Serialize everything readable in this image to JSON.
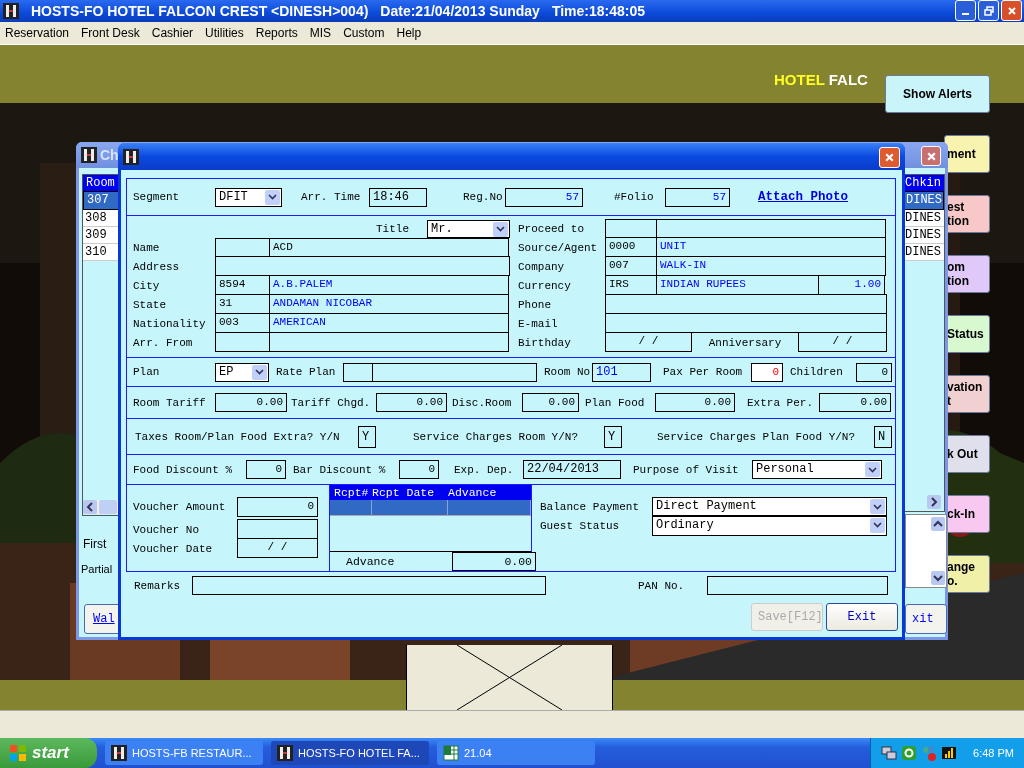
{
  "app_title": "HOSTS-FO HOTEL FALCON CREST <DINESH>004)",
  "app_date": "Date:21/04/2013 Sunday",
  "app_time": "Time:18:48:05",
  "menu": [
    "Reservation",
    "Front Desk",
    "Cashier",
    "Utilities",
    "Reports",
    "MIS",
    "Custom",
    "Help"
  ],
  "banner": {
    "highlight": "HOTEL",
    "rest": "FALC"
  },
  "side_buttons": [
    {
      "lines": [
        "Show Alerts"
      ],
      "color": "#c8f4fa",
      "kind": "full"
    },
    {
      "lines": [
        "ment"
      ],
      "color": "#f8f4b0",
      "kind": "cut"
    },
    {
      "lines": [
        "est",
        "tion"
      ],
      "color": "#f8c8c8",
      "kind": "cut"
    },
    {
      "lines": [
        "om",
        "tion"
      ],
      "color": "#e0c8f8",
      "kind": "cut"
    },
    {
      "lines": [
        "Status"
      ],
      "color": "#d8f8d0",
      "kind": "cut"
    },
    {
      "lines": [
        "vation",
        "t"
      ],
      "color": "#f0d0d0",
      "kind": "cut"
    },
    {
      "lines": [
        "k Out"
      ],
      "color": "#e0e0ec",
      "kind": "cut"
    },
    {
      "lines": [
        "ck-In"
      ],
      "color": "#f8c8f0",
      "kind": "cut"
    },
    {
      "lines": [
        "ange",
        "o."
      ],
      "color": "#f0f0a8",
      "kind": "cut"
    }
  ],
  "back_window": {
    "title": "Ch",
    "left_list": {
      "header": "Room",
      "rows": [
        {
          "text": "307",
          "selected": true
        },
        {
          "text": "308",
          "selected": false
        },
        {
          "text": "309",
          "selected": false
        },
        {
          "text": "310",
          "selected": false
        }
      ]
    },
    "right_list": {
      "header": "Chkin",
      "rows": [
        {
          "text": "DINES",
          "selected": true
        },
        {
          "text": "DINES",
          "selected": false
        },
        {
          "text": "DINES",
          "selected": false
        },
        {
          "text": "DINES",
          "selected": false
        }
      ]
    },
    "labels": [
      "First",
      "Partial"
    ],
    "left_button": "Wal",
    "right_button": "xit"
  },
  "dialog": {
    "segment": {
      "label": "Segment",
      "value": "DFIT"
    },
    "arr_time": {
      "label": "Arr. Time",
      "value": "18:46"
    },
    "reg_no": {
      "label": "Reg.No",
      "value": "57"
    },
    "folio": {
      "label": "#Folio",
      "value": "57"
    },
    "attach_photo": "Attach Photo",
    "title": {
      "label": "Title",
      "value": "Mr."
    },
    "left_fields": [
      {
        "label": "Name",
        "kind": "split",
        "value": "ACD",
        "linked": false
      },
      {
        "label": "Address",
        "kind": "single"
      },
      {
        "label": "City",
        "kind": "split",
        "code": "8594",
        "value": "A.B.PALEM",
        "linked": true
      },
      {
        "label": "State",
        "kind": "split",
        "code": "31",
        "value": "ANDAMAN NICOBAR",
        "linked": true
      },
      {
        "label": "Nationality",
        "kind": "split",
        "code": "003",
        "value": "AMERICAN",
        "linked": true
      },
      {
        "label": "Arr. From",
        "kind": "split"
      }
    ],
    "right_fields": [
      {
        "label": "Proceed to",
        "kind": "split"
      },
      {
        "label": "Source/Agent",
        "kind": "split",
        "code": "0000",
        "value": "UNIT",
        "linked": true
      },
      {
        "label": "Company",
        "kind": "split",
        "code": "007",
        "value": "WALK-IN",
        "linked": true
      },
      {
        "label": "Currency",
        "kind": "rate",
        "code": "IRS",
        "value": "INDIAN RUPEES",
        "rate": "1.00",
        "linked": true
      },
      {
        "label": "Phone",
        "kind": "single"
      },
      {
        "label": "E-mail",
        "kind": "single"
      },
      {
        "label": "Birthday",
        "kind": "date",
        "value": "/  /",
        "extra_label": "Anniversary",
        "extra_value": "/  /",
        "linked": false
      }
    ],
    "plan": {
      "label": "Plan",
      "value": "EP"
    },
    "rate_plan": {
      "label": "Rate Plan"
    },
    "room_no": {
      "label": "Room No",
      "value": "101"
    },
    "pax": {
      "label": "Pax Per Room",
      "value": "0"
    },
    "children": {
      "label": "Children",
      "value": "0"
    },
    "tariffs": [
      {
        "label": "Room Tariff",
        "value": "0.00"
      },
      {
        "label": "Tariff Chgd.",
        "value": "0.00"
      },
      {
        "label": "Disc.Room",
        "value": "0.00"
      },
      {
        "label": "Plan Food",
        "value": "0.00"
      },
      {
        "label": "Extra Per.",
        "value": "0.00"
      }
    ],
    "flags": [
      {
        "label": "Taxes Room/Plan Food Extra? Y/N",
        "value": "Y"
      },
      {
        "label": "Service Charges Room Y/N?",
        "value": "Y"
      },
      {
        "label": "Service Charges Plan Food Y/N?",
        "value": "N"
      }
    ],
    "food_discount": {
      "label": "Food Discount %",
      "value": "0"
    },
    "bar_discount": {
      "label": "Bar Discount %",
      "value": "0"
    },
    "exp_dep": {
      "label": "Exp. Dep.",
      "value": "22/04/2013"
    },
    "purpose": {
      "label": "Purpose of Visit",
      "value": "Personal"
    },
    "voucher": [
      {
        "label": "Voucher Amount",
        "value": "0"
      },
      {
        "label": "Voucher No"
      },
      {
        "label": "Voucher Date",
        "value": "/  /"
      }
    ],
    "receipts": {
      "columns": [
        "Rcpt#",
        "Rcpt Date",
        "Advance"
      ],
      "rows": [
        {
          "selected": true
        }
      ]
    },
    "advance": {
      "label": "Advance",
      "value": "0.00"
    },
    "balance_payment": {
      "label": "Balance Payment",
      "value": "Direct Payment"
    },
    "guest_status": {
      "label": "Guest Status",
      "value": "Ordinary"
    },
    "remarks": {
      "label": "Remarks"
    },
    "pan": {
      "label": "PAN No."
    },
    "buttons": [
      {
        "label": "Save[F12]",
        "disabled": true
      },
      {
        "label": "Exit",
        "disabled": false
      }
    ]
  },
  "taskbar": {
    "start": "start",
    "tasks": [
      {
        "label": "HOSTS-FB RESTAUR...",
        "kind": "app",
        "selected": false
      },
      {
        "label": "HOSTS-FO HOTEL FA...",
        "kind": "app",
        "selected": true
      },
      {
        "label": "21.04",
        "kind": "sheet",
        "selected": false
      }
    ],
    "clock": "6:48 PM"
  }
}
